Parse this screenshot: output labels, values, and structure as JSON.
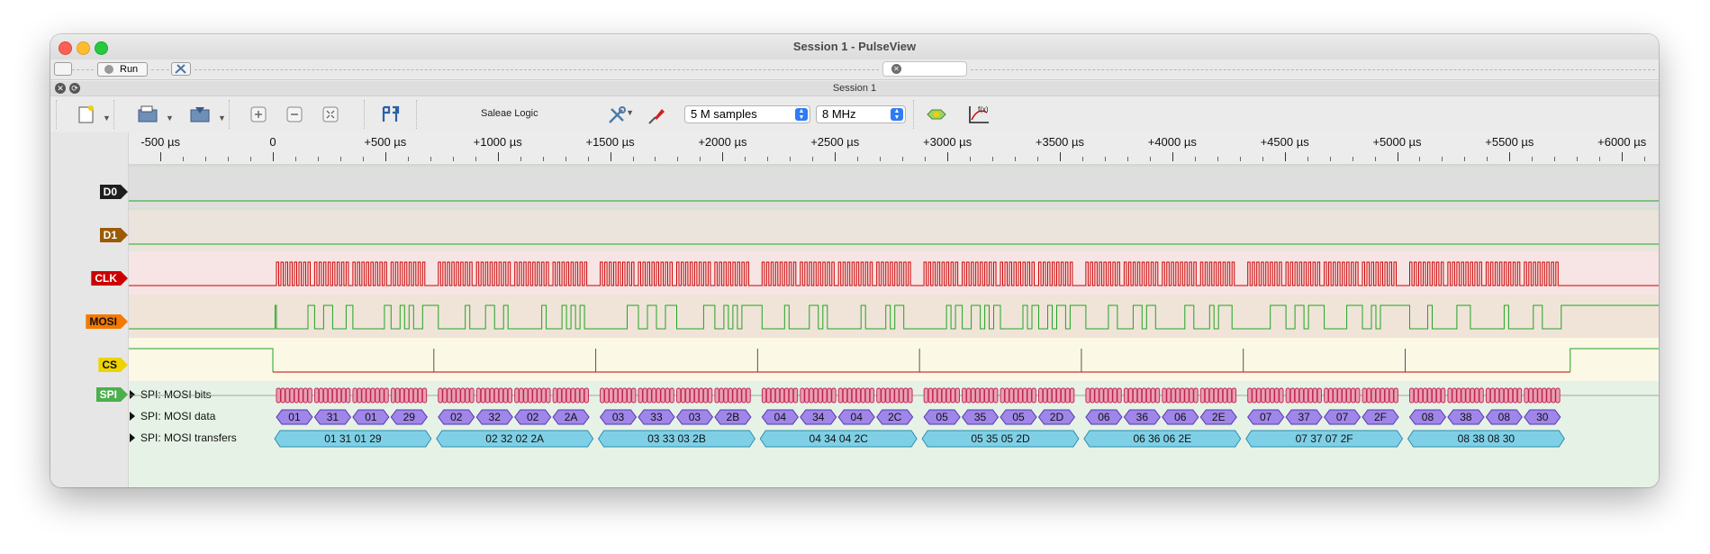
{
  "window": {
    "title": "Session 1 - PulseView"
  },
  "topbar": {
    "run_label": "Run",
    "search_clear_icon": "clear-icon"
  },
  "session": {
    "tab_label": "Session 1"
  },
  "toolbar": {
    "device": "Saleae Logic",
    "samples": "5 M samples",
    "samplerate": "8 MHz"
  },
  "timescale": {
    "labels": [
      "-500 µs",
      "0",
      "+500 µs",
      "+1000 µs",
      "+1500 µs",
      "+2000 µs",
      "+2500 µs",
      "+3000 µs",
      "+3500 µs",
      "+4000 µs",
      "+4500 µs",
      "+5000 µs",
      "+5500 µs",
      "+6000 µs"
    ],
    "values_us": [
      -500,
      0,
      500,
      1000,
      1500,
      2000,
      2500,
      3000,
      3500,
      4000,
      4500,
      5000,
      5500,
      6000
    ]
  },
  "channels": [
    {
      "name": "D0",
      "color": "#1e1e1e",
      "bg": "#dedede",
      "text": "#ffffff",
      "trace": "low"
    },
    {
      "name": "D1",
      "color": "#9b5a08",
      "bg": "#ebe4dc",
      "text": "#ffffff",
      "trace": "low"
    },
    {
      "name": "CLK",
      "color": "#cc0000",
      "bg": "#f7e4e4",
      "text": "#ffffff",
      "trace": "clock"
    },
    {
      "name": "MOSI",
      "color": "#f57900",
      "bg": "#f0e4d9",
      "text": "#111111",
      "trace": "data"
    },
    {
      "name": "CS",
      "color": "#edd400",
      "bg": "#fbf8e6",
      "text": "#111111",
      "trace": "cs"
    }
  ],
  "decoder": {
    "tag": "SPI",
    "tag_color": "#4caf4c",
    "bg": "#e6f2e6",
    "rows": [
      "SPI: MOSI bits",
      "SPI: MOSI data",
      "SPI: MOSI transfers"
    ],
    "frame_start_us": 16,
    "frame_period_us": 720,
    "byte_period_us": 170,
    "byte_width_us": 160,
    "data_bytes": [
      [
        "01",
        "31",
        "01",
        "29"
      ],
      [
        "02",
        "32",
        "02",
        "2A"
      ],
      [
        "03",
        "33",
        "03",
        "2B"
      ],
      [
        "04",
        "34",
        "04",
        "2C"
      ],
      [
        "05",
        "35",
        "05",
        "2D"
      ],
      [
        "06",
        "36",
        "06",
        "2E"
      ],
      [
        "07",
        "37",
        "07",
        "2F"
      ],
      [
        "08",
        "38",
        "08",
        "30"
      ]
    ],
    "transfers": [
      "01 31 01 29",
      "02 32 02 2A",
      "03 33 03 2B",
      "04 34 04 2C",
      "05 35 05 2D",
      "06 36 06 2E",
      "07 37 07 2F",
      "08 38 08 30"
    ],
    "cs_low_start_us": 0,
    "cs_low_end_us": 5770,
    "colors": {
      "bits_fill": "#e8a0b4",
      "bits_stroke": "#c0204c",
      "data_fill": "#9f86e8",
      "data_stroke": "#5535b5",
      "transfer_fill": "#7fd0e6",
      "transfer_stroke": "#2a8fb0",
      "trace_high": "#22a322",
      "trace_low": "#cc0000"
    }
  }
}
